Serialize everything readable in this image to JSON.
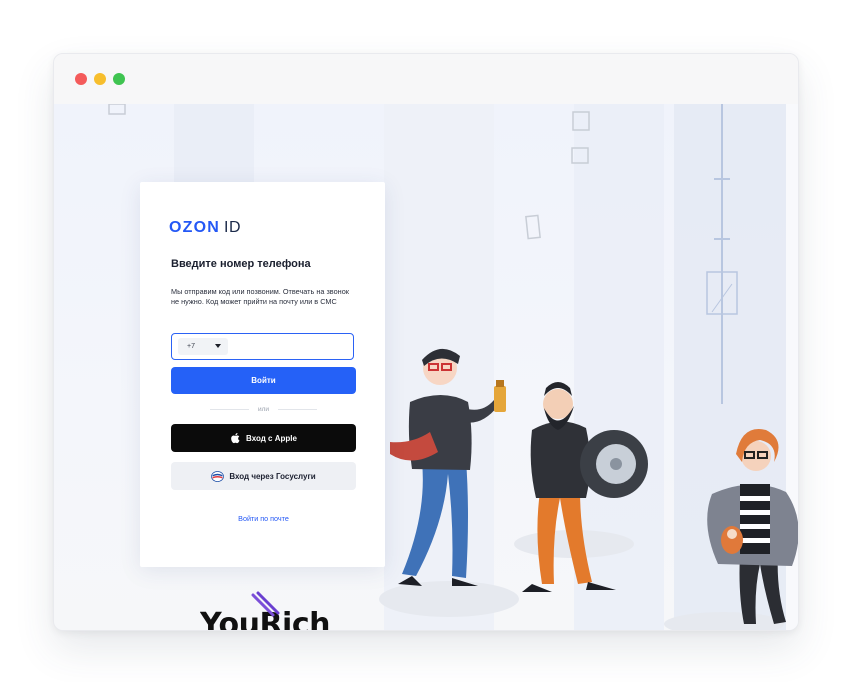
{
  "window": {
    "controls": [
      "close",
      "minimize",
      "maximize"
    ],
    "colors": {
      "close": "#f45b5b",
      "minimize": "#f7be2d",
      "maximize": "#3fc451"
    }
  },
  "login": {
    "logo_brand": "OZON",
    "logo_suffix": "ID",
    "heading": "Введите номер телефона",
    "description": "Мы отправим код или позвоним. Отвечать на звонок не нужно. Код может прийти на почту или в СМС",
    "country_code": "+7",
    "phone_value": "",
    "login_button": "Войти",
    "or_text": "или",
    "apple_button": "Вход с Apple",
    "gosuslugi_button": "Вход через Госуслуги",
    "email_link": "Войти по почте"
  },
  "watermark": {
    "text": "YouRich"
  },
  "colors": {
    "accent": "#2561f7",
    "apple": "#0b0b0b",
    "secondary": "#eef0f4"
  },
  "icons": [
    "apple-icon",
    "gosuslugi-icon",
    "chevron-down-icon"
  ]
}
